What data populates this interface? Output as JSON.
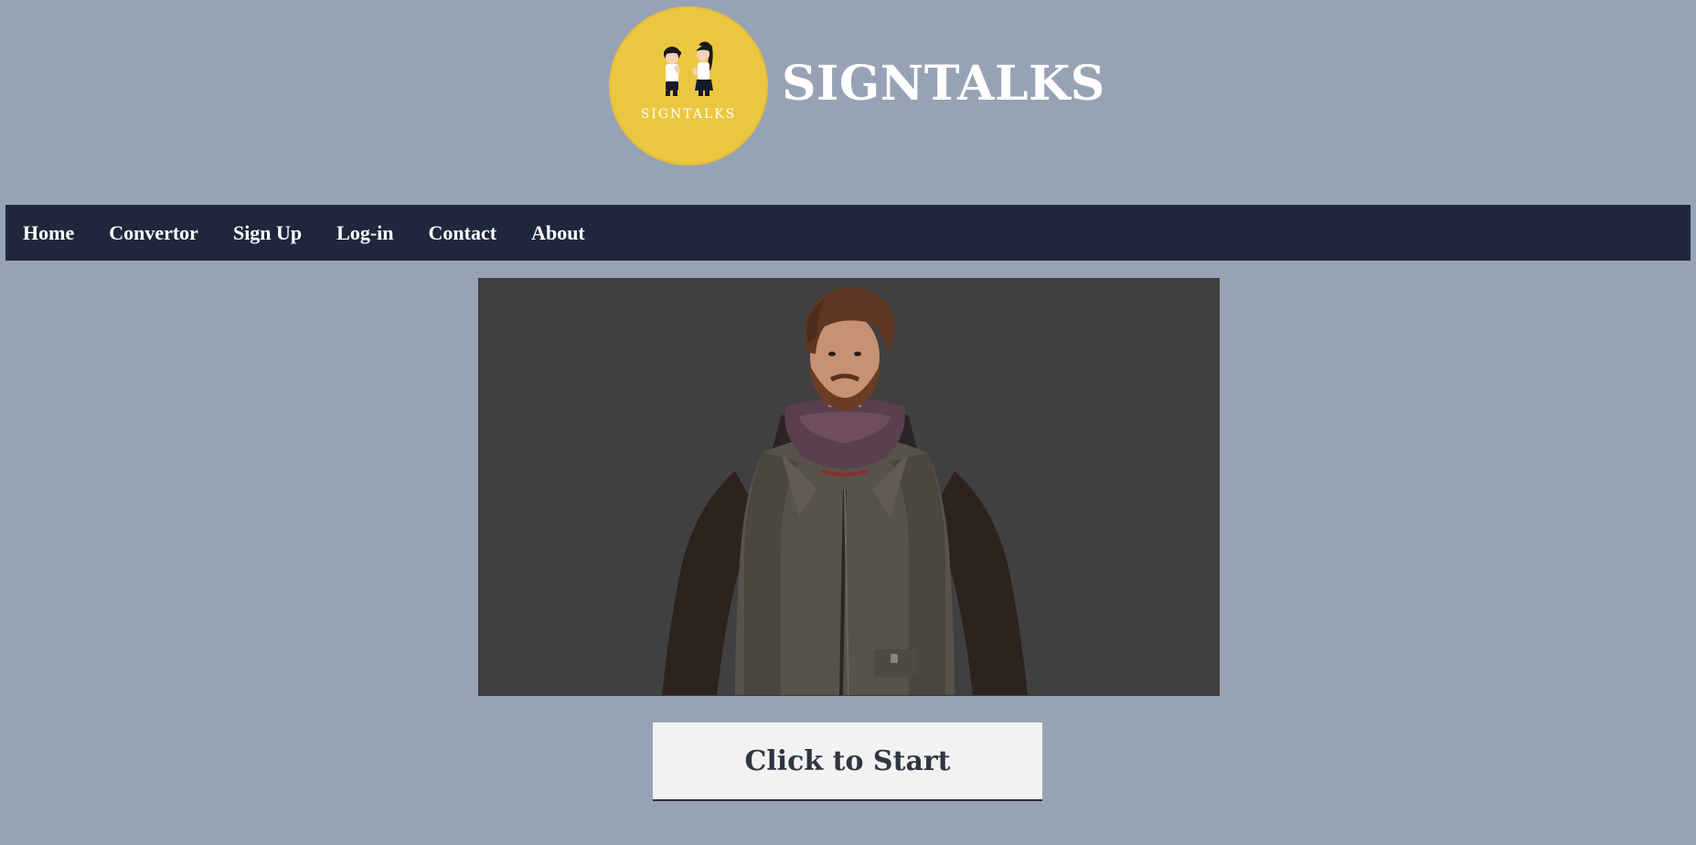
{
  "header": {
    "logo_text": "SIGNTALKS",
    "title": "SIGNTALKS"
  },
  "nav": {
    "items": [
      {
        "label": "Home"
      },
      {
        "label": "Convertor"
      },
      {
        "label": "Sign Up"
      },
      {
        "label": "Log-in"
      },
      {
        "label": "Contact"
      },
      {
        "label": "About"
      }
    ]
  },
  "viewer": {
    "subject": "3d-avatar"
  },
  "start_button": {
    "label": "Click to Start"
  },
  "colors": {
    "page_bg": "#97a2b5",
    "nav_bg": "#1f273c",
    "logo_circle": "#ebc740",
    "viewer_bg": "#404040",
    "button_bg": "#f2f2f2",
    "button_text": "#2f3642"
  }
}
